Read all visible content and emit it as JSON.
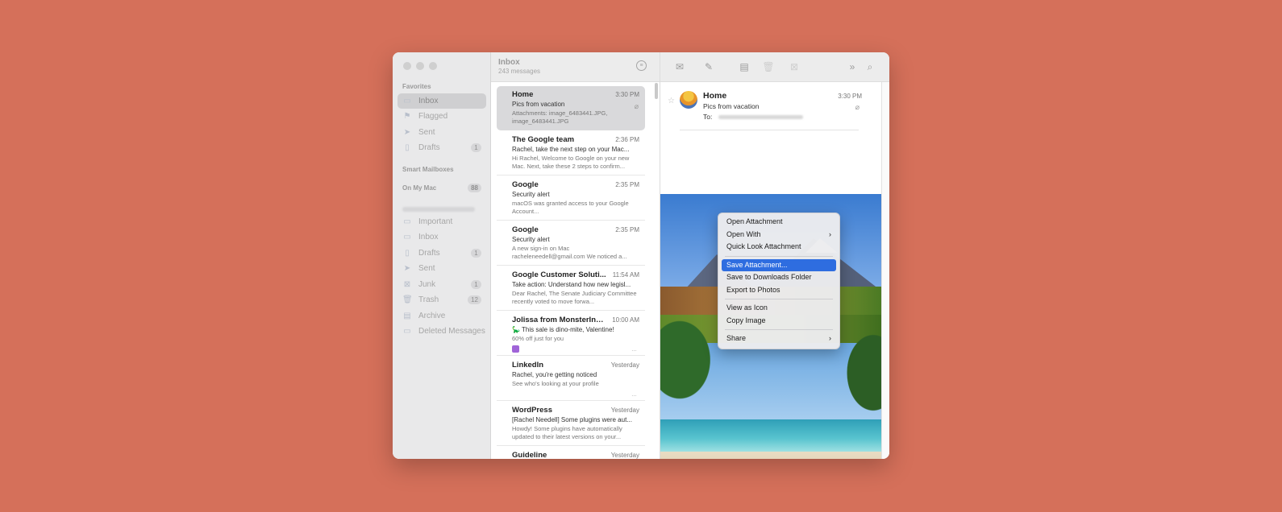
{
  "sidebar": {
    "favorites_header": "Favorites",
    "favorites": [
      {
        "label": "Inbox",
        "icon": "inbox-icon",
        "badge": ""
      },
      {
        "label": "Flagged",
        "icon": "flag-icon",
        "badge": ""
      },
      {
        "label": "Sent",
        "icon": "paperplane-icon",
        "badge": ""
      },
      {
        "label": "Drafts",
        "icon": "document-icon",
        "badge": "1"
      }
    ],
    "smart_header": "Smart Mailboxes",
    "onmymac_label": "On My Mac",
    "onmymac_badge": "88",
    "account_items": [
      {
        "label": "Important",
        "icon": "folder-icon",
        "badge": ""
      },
      {
        "label": "Inbox",
        "icon": "inbox-icon",
        "badge": ""
      },
      {
        "label": "Drafts",
        "icon": "document-icon",
        "badge": "1"
      },
      {
        "label": "Sent",
        "icon": "paperplane-icon",
        "badge": ""
      },
      {
        "label": "Junk",
        "icon": "junk-icon",
        "badge": "1"
      },
      {
        "label": "Trash",
        "icon": "trash-icon",
        "badge": "12"
      },
      {
        "label": "Archive",
        "icon": "archive-icon",
        "badge": ""
      },
      {
        "label": "Deleted Messages",
        "icon": "folder-icon",
        "badge": ""
      }
    ]
  },
  "list": {
    "title": "Inbox",
    "subtitle": "243 messages",
    "messages": [
      {
        "from": "Home",
        "time": "3:30 PM",
        "subject": "Pics from vacation",
        "preview": "Attachments: image_6483441.JPG, image_6483441.JPG"
      },
      {
        "from": "The Google team",
        "time": "2:36 PM",
        "subject": "Rachel, take the next step on your Mac...",
        "preview": "Hi Rachel, Welcome to Google on your new Mac. Next, take these 2 steps to confirm..."
      },
      {
        "from": "Google",
        "time": "2:35 PM",
        "subject": "Security alert",
        "preview": "macOS was granted access to your Google Account..."
      },
      {
        "from": "Google",
        "time": "2:35 PM",
        "subject": "Security alert",
        "preview": "A new sign-in on Mac racheleneedell@gmail.com We noticed a..."
      },
      {
        "from": "Google Customer Soluti...",
        "time": "11:54 AM",
        "subject": "Take action: Understand how new legisl...",
        "preview": "Dear Rachel, The Senate Judiciary Committee recently voted to move forwa..."
      },
      {
        "from": "Jolissa from MonsterInsi...",
        "time": "10:00 AM",
        "subject": "🦕 This sale is dino-mite, Valentine!",
        "preview": "60% off just for you"
      },
      {
        "from": "LinkedIn",
        "time": "Yesterday",
        "subject": "Rachel, you're getting noticed",
        "preview": "See who's looking at your profile"
      },
      {
        "from": "WordPress",
        "time": "Yesterday",
        "subject": "[Rachel Needell] Some plugins were aut...",
        "preview": "Howdy! Some plugins have automatically updated to their latest versions on your..."
      },
      {
        "from": "Guideline",
        "time": "Yesterday",
        "subject": "",
        "preview": ""
      }
    ]
  },
  "reader": {
    "from": "Home",
    "subject": "Pics from vacation",
    "to_label": "To:",
    "time": "3:30 PM"
  },
  "context_menu": {
    "group1": [
      "Open Attachment",
      "Open With",
      "Quick Look Attachment"
    ],
    "group2": [
      "Save Attachment...",
      "Save to Downloads Folder",
      "Export to Photos"
    ],
    "group3": [
      "View as Icon",
      "Copy Image"
    ],
    "group4": [
      "Share"
    ]
  },
  "colors": {
    "background": "#d5705a",
    "menu_highlight": "#2e6de0"
  }
}
